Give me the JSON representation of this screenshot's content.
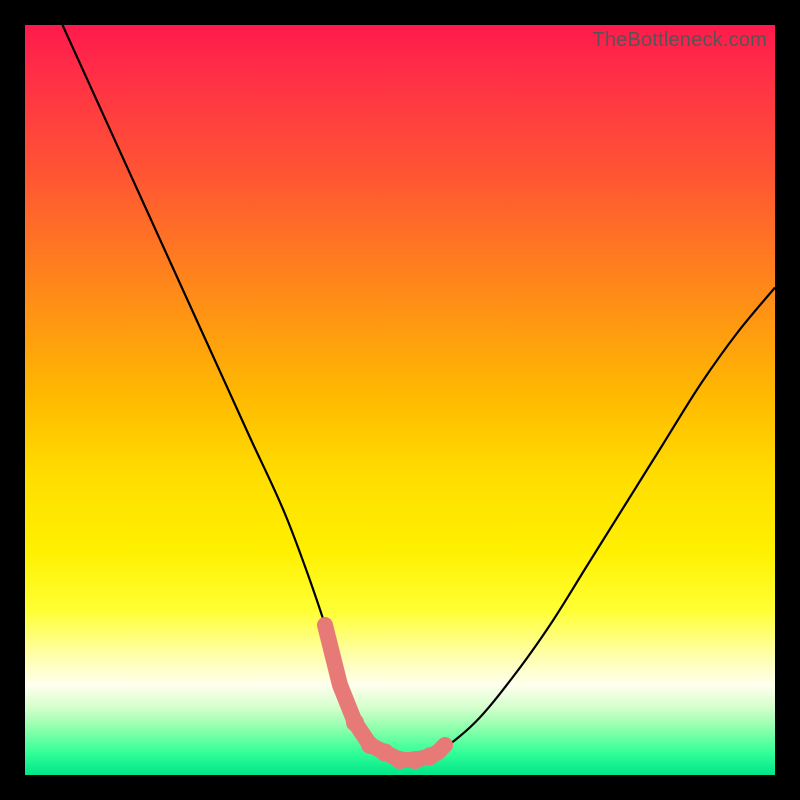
{
  "watermark": "TheBottleneck.com",
  "chart_data": {
    "type": "line",
    "title": "",
    "xlabel": "",
    "ylabel": "",
    "ylim": [
      0,
      100
    ],
    "xlim": [
      0,
      100
    ],
    "series": [
      {
        "name": "bottleneck-curve",
        "x": [
          5,
          10,
          15,
          20,
          25,
          30,
          35,
          40,
          42,
          45,
          48,
          50,
          52,
          55,
          60,
          65,
          70,
          75,
          80,
          85,
          90,
          95,
          100
        ],
        "values": [
          100,
          89,
          78,
          67,
          56,
          45,
          34,
          20,
          12,
          6,
          3,
          2,
          2,
          3,
          7,
          13,
          20,
          28,
          36,
          44,
          52,
          59,
          65
        ]
      }
    ],
    "markers": {
      "name": "highlight-dots",
      "color": "#e77a77",
      "points_x": [
        40,
        42,
        44,
        46,
        48,
        50,
        52,
        54,
        55,
        56
      ],
      "points_y": [
        20,
        12,
        7,
        4,
        3,
        2,
        2,
        2.5,
        3,
        4
      ]
    }
  },
  "colors": {
    "curve": "#000000",
    "marker": "#e77a77"
  }
}
